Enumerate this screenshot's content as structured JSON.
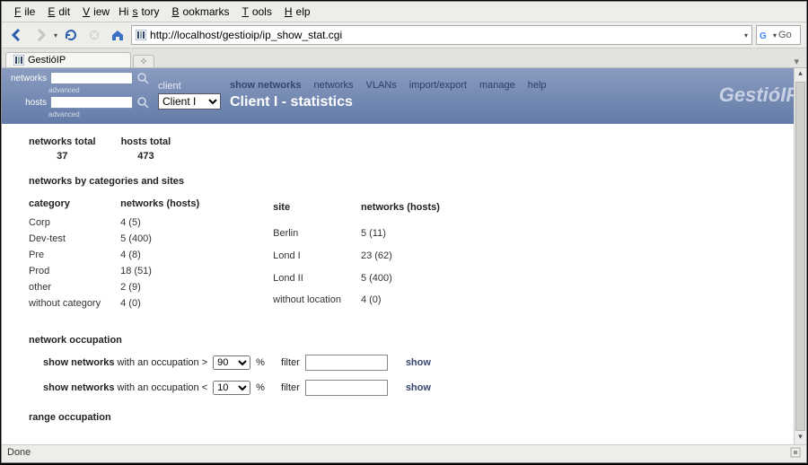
{
  "menu": {
    "items": [
      "File",
      "Edit",
      "View",
      "History",
      "Bookmarks",
      "Tools",
      "Help"
    ]
  },
  "toolbar": {
    "url": "http://localhost/gestioip/ip_show_stat.cgi",
    "search_engine": "Go"
  },
  "tab": {
    "title": "GestióIP"
  },
  "apphdr": {
    "search_networks": "networks",
    "search_hosts": "hosts",
    "advanced": "advanced",
    "client_label": "client",
    "client_value": "Client I",
    "nav": {
      "main": "show networks",
      "items": [
        "networks",
        "VLANs",
        "import/export",
        "manage",
        "help"
      ]
    },
    "subtitle": "Client I - statistics",
    "brand": "GestióIP"
  },
  "totals": {
    "networks_label": "networks total",
    "networks_value": "37",
    "hosts_label": "hosts total",
    "hosts_value": "473"
  },
  "sect_cat_sites": "networks by categories and sites",
  "cat_table": {
    "headers": [
      "category",
      "networks (hosts)"
    ],
    "rows": [
      [
        "Corp",
        "4 (5)"
      ],
      [
        "Dev-test",
        "5 (400)"
      ],
      [
        "Pre",
        "4 (8)"
      ],
      [
        "Prod",
        "18 (51)"
      ],
      [
        "other",
        "2 (9)"
      ],
      [
        "without category",
        "4 (0)"
      ]
    ]
  },
  "site_table": {
    "headers": [
      "site",
      "networks (hosts)"
    ],
    "rows": [
      [
        "Berlin",
        "5 (11)"
      ],
      [
        "Lond I",
        "23 (62)"
      ],
      [
        "Lond II",
        "5 (400)"
      ],
      [
        "without location",
        "4 (0)"
      ]
    ]
  },
  "sect_occ": "network occupation",
  "occ_gt": {
    "prefix_bold": "show networks",
    "prefix_rest": " with an occupation > ",
    "value": "90",
    "pct": "%",
    "filter_label": "filter",
    "show": "show"
  },
  "occ_lt": {
    "prefix_bold": "show networks",
    "prefix_rest": " with an occupation < ",
    "value": "10",
    "pct": "%",
    "filter_label": "filter",
    "show": "show"
  },
  "sect_range": "range occupation",
  "status": {
    "left": "Done"
  }
}
